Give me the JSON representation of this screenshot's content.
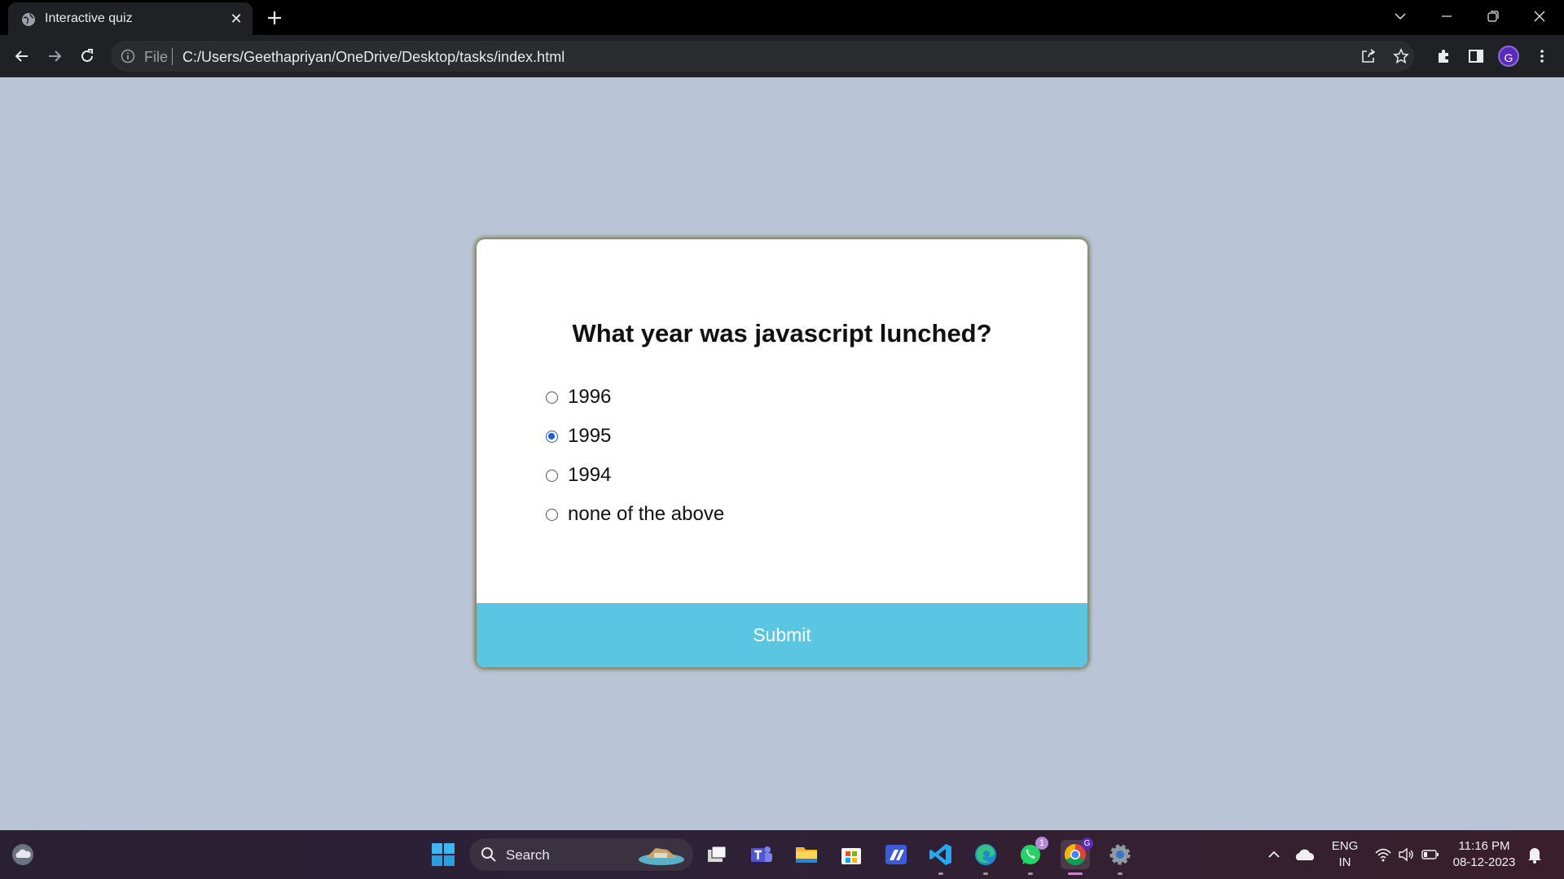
{
  "browser": {
    "tab_title": "Interactive quiz",
    "tab_close": "✕",
    "url_scheme": "File",
    "url": "C:/Users/Geethapriyan/OneDrive/Desktop/tasks/index.html",
    "profile_initial": "G"
  },
  "quiz": {
    "question": "What year was javascript lunched?",
    "options": [
      {
        "label": "1996",
        "selected": false
      },
      {
        "label": "1995",
        "selected": true
      },
      {
        "label": "1994",
        "selected": false
      },
      {
        "label": "none of the above",
        "selected": false
      }
    ],
    "submit_label": "Submit"
  },
  "taskbar": {
    "search_placeholder": "Search",
    "whatsapp_badge": "1",
    "chrome_badge": "G",
    "language_line1": "ENG",
    "language_line2": "IN",
    "time": "11:16 PM",
    "date": "08-12-2023"
  },
  "colors": {
    "page_background": "#b9c4d7",
    "submit_button": "#5ac6e2",
    "radio_checked": "#1a5fd1",
    "card_shadow": "#6e6f3a"
  }
}
